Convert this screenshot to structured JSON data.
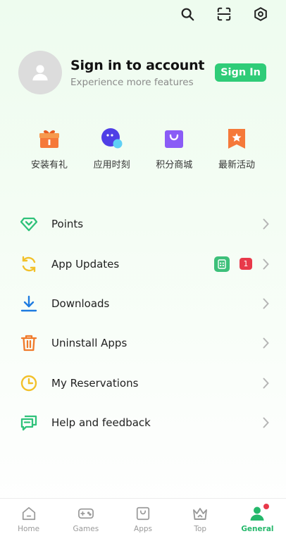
{
  "topbar": {
    "icons": [
      "search-icon",
      "scan-icon",
      "settings-icon"
    ]
  },
  "profile": {
    "title": "Sign in to account",
    "subtitle": "Experience more features",
    "button": "Sign In"
  },
  "quick_actions": [
    {
      "label": "安装有礼",
      "icon": "gift-icon",
      "color": "#f5793a"
    },
    {
      "label": "应用时刻",
      "icon": "app-moment-icon",
      "color": "#5b4ff0"
    },
    {
      "label": "积分商城",
      "icon": "shopping-bag-icon",
      "color": "#8a5cf6"
    },
    {
      "label": "最新活动",
      "icon": "star-banner-icon",
      "color": "#f5793a"
    }
  ],
  "menu": [
    {
      "label": "Points",
      "icon": "diamond-icon",
      "color": "#2fc27a"
    },
    {
      "label": "App Updates",
      "icon": "refresh-icon",
      "color": "#f2c029",
      "badge_count": "1"
    },
    {
      "label": "Downloads",
      "icon": "download-icon",
      "color": "#1e7be0"
    },
    {
      "label": "Uninstall Apps",
      "icon": "trash-icon",
      "color": "#f07a2a"
    },
    {
      "label": "My Reservations",
      "icon": "clock-icon",
      "color": "#f2c029"
    },
    {
      "label": "Help and feedback",
      "icon": "chat-icon",
      "color": "#2fc27a"
    }
  ],
  "bottom_nav": [
    {
      "label": "Home",
      "icon": "home-icon"
    },
    {
      "label": "Games",
      "icon": "gamepad-icon"
    },
    {
      "label": "Apps",
      "icon": "apps-bag-icon"
    },
    {
      "label": "Top",
      "icon": "crown-icon"
    },
    {
      "label": "General",
      "icon": "person-icon",
      "active": true
    }
  ],
  "colors": {
    "accent": "#2fcc78",
    "badge_red": "#e8394a",
    "inactive": "#9a9a9a"
  }
}
